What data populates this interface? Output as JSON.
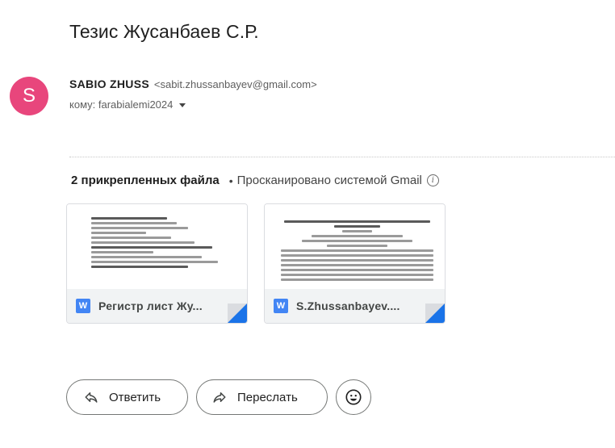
{
  "email": {
    "subject": "Тезис Жусанбаев С.Р.",
    "sender": {
      "avatar_letter": "S",
      "avatar_color": "#e8467c",
      "name": "SABIO ZHUSS",
      "email": "<sabit.zhussanbayev@gmail.com>"
    },
    "recipient": "кому: farabialemi2024"
  },
  "attachments": {
    "count_label": "2 прикрепленных файла",
    "separator": "•",
    "scan_label": "Просканировано системой Gmail",
    "info_icon": "info-icon",
    "files": [
      {
        "name": "Регистр лист Жу...",
        "icon": "word-doc-icon"
      },
      {
        "name": "S.Zhussanbayev....",
        "icon": "word-doc-icon"
      }
    ]
  },
  "actions": {
    "reply_label": "Ответить",
    "reply_icon": "reply-icon",
    "forward_label": "Переслать",
    "forward_icon": "forward-icon",
    "emoji_icon": "emoji-icon"
  },
  "colors": {
    "accent": "#1a73e8",
    "word_blue": "#4285f4"
  }
}
